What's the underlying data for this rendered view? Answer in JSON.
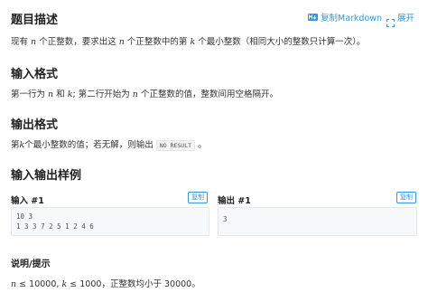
{
  "sections": {
    "description": {
      "title": "题目描述",
      "text_a": "现有",
      "var_n": "n",
      "text_b": "个正整数，要求出这",
      "text_c": "个正整数中的第",
      "var_k": "k",
      "text_d": "个最小整数（相同大小的整数只计算一次）。"
    },
    "input": {
      "title": "输入格式",
      "text_a": "第一行为",
      "var_n": "n",
      "text_and": "和",
      "var_k": "k",
      "text_b": "; 第二行开始为",
      "text_c": "个正整数的值，整数间用空格隔开。"
    },
    "output": {
      "title": "输出格式",
      "text_a": "第",
      "var_k": "k",
      "text_b": "个最小整数的值；若无解，则输出",
      "code": "NO RESULT",
      "text_c": "。"
    },
    "samples": {
      "title": "输入输出样例",
      "input_label": "输入 #1",
      "output_label": "输出 #1",
      "copy_label": "复制",
      "input_lines": [
        "10 3",
        "1 3 3 7 2 5 1 2 4 6"
      ],
      "output_lines": [
        "3"
      ]
    },
    "hint": {
      "title": "说明/提示",
      "var_n": "n",
      "leq": "≤",
      "n_max": "10000",
      "comma": ",",
      "var_k": "k",
      "k_max": "1000",
      "text": "，正整数均小于",
      "limit": "30000",
      "end": "。"
    }
  },
  "toolbar": {
    "copy_markdown_label": "复制Markdown",
    "expand_label": "展开"
  },
  "colors": {
    "accent": "#3498db",
    "heading": "#222222"
  }
}
